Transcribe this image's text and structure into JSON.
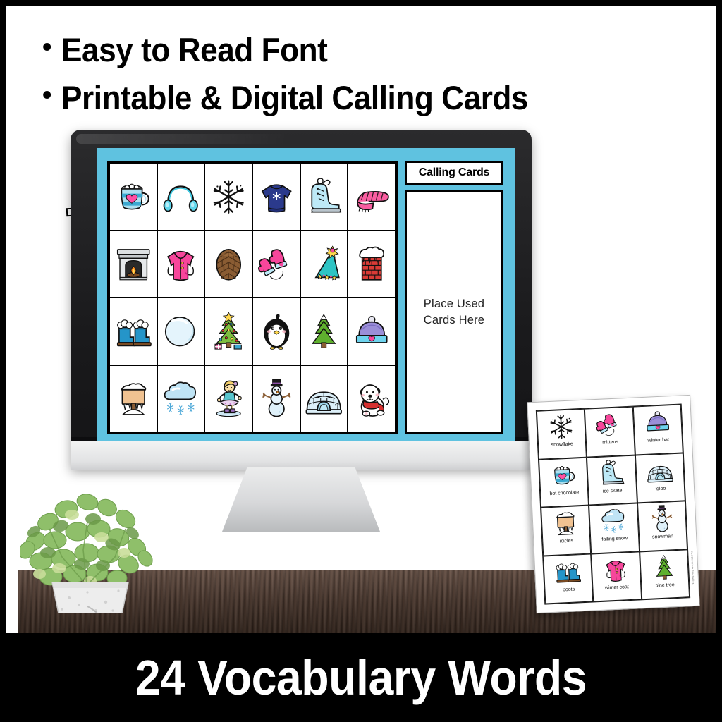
{
  "headline": {
    "bullet_char": "•",
    "lines": [
      "Easy to Read Font",
      "Printable & Digital Calling Cards"
    ]
  },
  "footer_banner": {
    "text": "24 Vocabulary Words"
  },
  "colors": {
    "slide_blue": "#5FC2E0",
    "bezel_black": "#1a1a1c",
    "banner_black": "#000000",
    "desk_wood": "#4a3327",
    "card_white": "#ffffff"
  },
  "slide": {
    "calling_cards_title": "Calling Cards",
    "place_used_line1": "Place Used",
    "place_used_line2": "Cards Here",
    "bingo_grid": {
      "rows": 4,
      "columns": 6,
      "cells": [
        {
          "icon": "hot-chocolate-icon",
          "name": "hot chocolate"
        },
        {
          "icon": "ear-muffs-icon",
          "name": "ear muffs"
        },
        {
          "icon": "snowflake-icon",
          "name": "snowflake"
        },
        {
          "icon": "sweater-icon",
          "name": "sweater"
        },
        {
          "icon": "ice-skate-icon",
          "name": "ice skate"
        },
        {
          "icon": "scarf-icon",
          "name": "scarf"
        },
        {
          "icon": "fireplace-icon",
          "name": "fireplace"
        },
        {
          "icon": "winter-coat-icon",
          "name": "winter coat"
        },
        {
          "icon": "pine-cone-icon",
          "name": "pine cone"
        },
        {
          "icon": "mittens-icon",
          "name": "mittens"
        },
        {
          "icon": "party-hat-icon",
          "name": "party hat"
        },
        {
          "icon": "chimney-icon",
          "name": "chimney"
        },
        {
          "icon": "boots-icon",
          "name": "boots"
        },
        {
          "icon": "snowball-icon",
          "name": "snowball"
        },
        {
          "icon": "christmas-tree-icon",
          "name": "christmas tree"
        },
        {
          "icon": "penguin-icon",
          "name": "penguin"
        },
        {
          "icon": "pine-tree-icon",
          "name": "pine tree"
        },
        {
          "icon": "winter-hat-icon",
          "name": "winter hat"
        },
        {
          "icon": "icicles-icon",
          "name": "icicles"
        },
        {
          "icon": "falling-snow-icon",
          "name": "falling snow"
        },
        {
          "icon": "ice-skater-icon",
          "name": "ice skater"
        },
        {
          "icon": "snowman-icon",
          "name": "snowman"
        },
        {
          "icon": "igloo-icon",
          "name": "igloo"
        },
        {
          "icon": "polar-bear-icon",
          "name": "polar bear"
        }
      ]
    }
  },
  "card_sheet": {
    "rows": 4,
    "columns": 3,
    "credit": "Hot Chocolate Teachables",
    "cards": [
      {
        "icon": "snowflake-icon",
        "label": "snowflake"
      },
      {
        "icon": "mittens-icon",
        "label": "mittens"
      },
      {
        "icon": "winter-hat-icon",
        "label": "winter hat"
      },
      {
        "icon": "hot-chocolate-icon",
        "label": "hot chocolate"
      },
      {
        "icon": "ice-skate-icon",
        "label": "ice skate"
      },
      {
        "icon": "igloo-icon",
        "label": "igloo"
      },
      {
        "icon": "icicles-icon",
        "label": "icicles"
      },
      {
        "icon": "falling-snow-icon",
        "label": "falling snow"
      },
      {
        "icon": "snowman-icon",
        "label": "snowman"
      },
      {
        "icon": "boots-icon",
        "label": "boots"
      },
      {
        "icon": "winter-coat-icon",
        "label": "winter coat"
      },
      {
        "icon": "pine-tree-icon",
        "label": "pine tree"
      }
    ]
  },
  "decor": {
    "plant_name": "potted eucalyptus plant",
    "monitor_name": "desktop monitor",
    "desk_name": "wooden desk"
  }
}
